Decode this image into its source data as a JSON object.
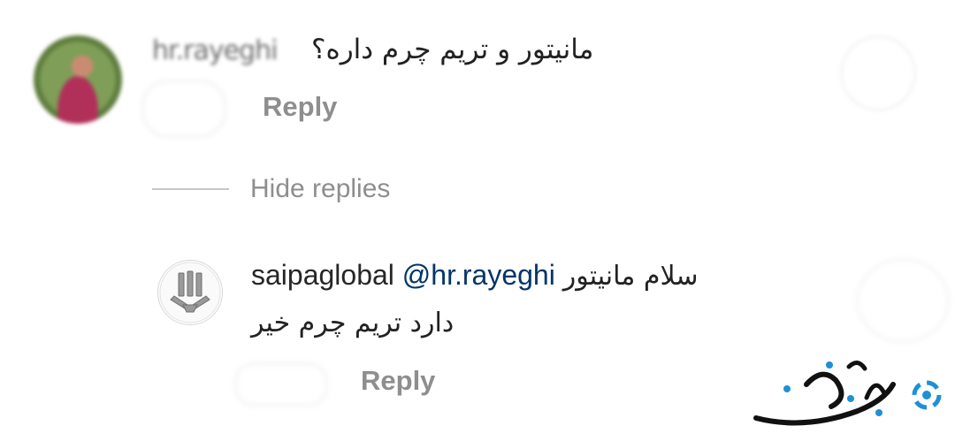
{
  "comment": {
    "username": "hr.rayeghi",
    "text": "مانیتور و تریم چرم داره؟",
    "reply_label": "Reply"
  },
  "thread": {
    "hide_replies_label": "Hide replies"
  },
  "reply": {
    "username": "saipaglobal",
    "mention": "@hr.rayeghi",
    "text_line1": "سلام مانیتور",
    "text_line2": "دارد تریم چرم خیر",
    "reply_label": "Reply"
  },
  "watermark": {
    "text": "جیرنا"
  },
  "colors": {
    "secondary_text": "#8e8e8e",
    "mention": "#003569",
    "watermark_accent": "#1e90d6"
  }
}
